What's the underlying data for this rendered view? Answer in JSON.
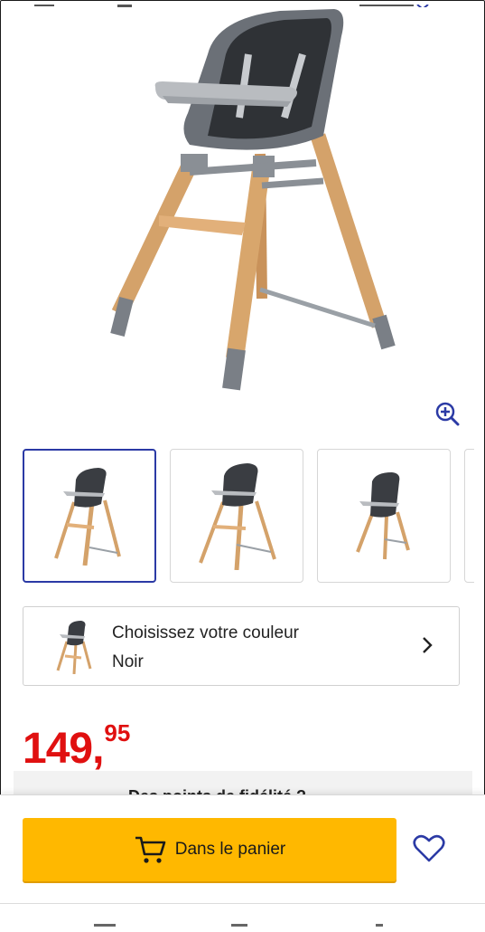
{
  "product": {
    "image_alt": "High chair with wooden legs",
    "thumbnails": [
      "thumbnail-1",
      "thumbnail-2",
      "thumbnail-3"
    ]
  },
  "color_selector": {
    "title": "Choisissez votre couleur",
    "value": "Noir"
  },
  "price": {
    "integer": "149,",
    "decimals": "95"
  },
  "section_header": "Des points de fidélité ?",
  "actions": {
    "add_to_cart": "Dans le panier"
  },
  "colors": {
    "accent_yellow": "#ffb800",
    "price_red": "#e01010",
    "link_blue": "#2b3aa5"
  },
  "icons": [
    "zoom-in-icon",
    "chevron-right-icon",
    "cart-icon",
    "heart-icon"
  ]
}
